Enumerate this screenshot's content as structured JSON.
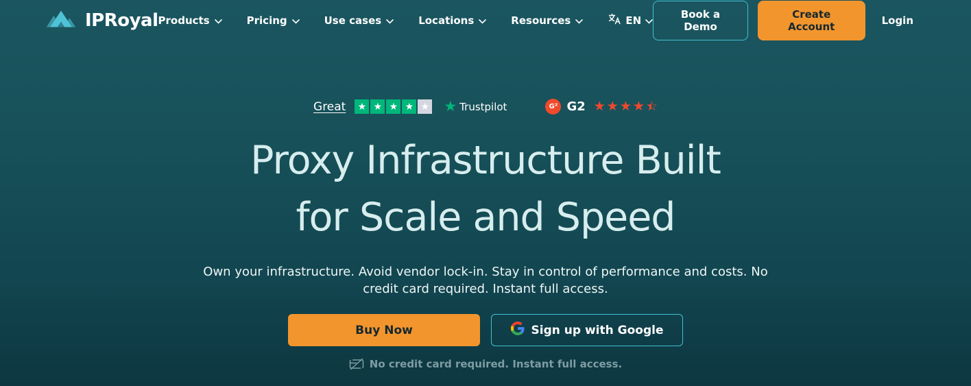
{
  "brand": {
    "name": "IPRoyal"
  },
  "nav": {
    "items": [
      {
        "label": "Products"
      },
      {
        "label": "Pricing"
      },
      {
        "label": "Use cases"
      },
      {
        "label": "Locations"
      },
      {
        "label": "Resources"
      }
    ],
    "language": {
      "label": "EN"
    }
  },
  "header_actions": {
    "book_demo": "Book a Demo",
    "create_account": "Create Account",
    "login": "Login"
  },
  "ratings": {
    "trustpilot": {
      "grade": "Great",
      "stars_filled": 4,
      "stars_total": 5,
      "brand": "Trustpilot"
    },
    "g2": {
      "brand": "G2",
      "stars": 4.5
    }
  },
  "hero": {
    "title_line1": "Proxy Infrastructure Built",
    "title_line2": "for Scale and Speed",
    "subtitle": "Own your infrastructure. Avoid vendor lock-in. Stay in control of performance and costs. No credit card required. Instant full access.",
    "primary_cta": "Buy Now",
    "google_cta": "Sign up with Google",
    "note": "No credit card required. Instant full access."
  },
  "icons": {
    "logo": "crown-icon",
    "nav_chevron": "chevron-down-icon",
    "language": "translate-icon",
    "trustpilot_star": "trustpilot-star-icon",
    "g2_badge": "g2-badge-icon",
    "google": "google-g-icon",
    "note": "credit-card-slash-icon"
  },
  "colors": {
    "background_top": "#1b5660",
    "background_bottom": "#0d3640",
    "accent_orange": "#f2952d",
    "accent_teal_border": "#3fc1d2",
    "heading": "#d7edee",
    "trustpilot_green": "#00b67a",
    "trustpilot_grey_star": "#d5d7e0",
    "g2_red": "#f0492c",
    "muted_note": "#7e9da3",
    "logo_light": "#4ec3d5",
    "logo_dark": "#3a95a6"
  }
}
